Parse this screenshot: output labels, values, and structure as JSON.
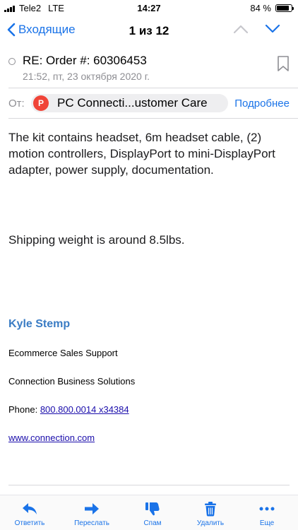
{
  "status_bar": {
    "carrier": "Tele2",
    "network": "LTE",
    "time": "14:27",
    "battery_text": "84 %",
    "battery_level": 0.84
  },
  "nav": {
    "back_label": "Входящие",
    "counter": "1 из 12"
  },
  "message": {
    "subject": "RE: Order #: 60306453",
    "date": "21:52, пт, 23 октября 2020 г.",
    "from_label": "От:",
    "sender_initial": "P",
    "sender_name": "PC Connecti...ustomer Care",
    "details_label": "Подробнее"
  },
  "body": {
    "paragraph1": "The kit contains headset, 6m headset cable, (2) motion controllers, DisplayPort to mini-DisplayPort adapter, power supply, documentation.",
    "paragraph2": "Shipping weight is around 8.5lbs."
  },
  "signature": {
    "name": "Kyle Stemp",
    "title": "Ecommerce Sales Support",
    "company": "Connection Business Solutions",
    "phone_label": "Phone: ",
    "phone": "800.800.0014 x34384",
    "website": "www.connection.com"
  },
  "tab_bar": {
    "reply": "Ответить",
    "forward": "Переслать",
    "spam": "Спам",
    "delete": "Удалить",
    "more": "Еще"
  },
  "colors": {
    "accent": "#1a73e8",
    "avatar": "#f04438",
    "signature_name": "#3a7cc4"
  }
}
